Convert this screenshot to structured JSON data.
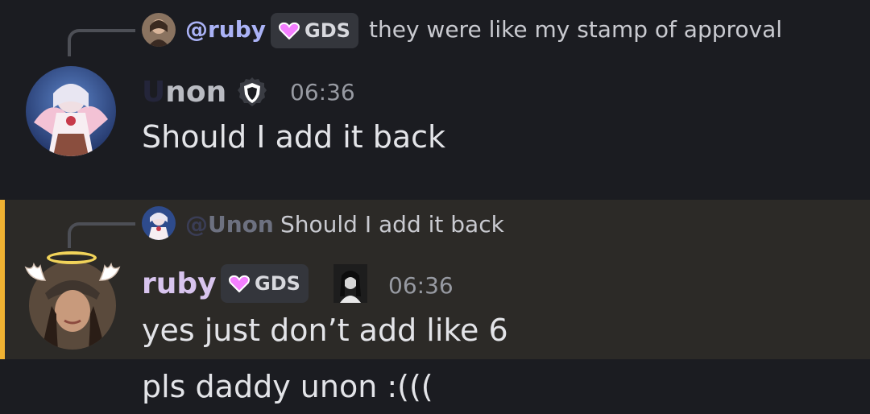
{
  "messages": [
    {
      "reply": {
        "mention": "@ruby",
        "tag": "GDS",
        "text": "they were like my stamp of approval"
      },
      "author": {
        "name_first": "U",
        "name_rest": "non"
      },
      "timestamp": "06:36",
      "content": "Should I add it back"
    },
    {
      "reply": {
        "mention_at": "@",
        "mention_name": "Unon",
        "text": "Should I add it back"
      },
      "author": {
        "name": "ruby",
        "tag": "GDS"
      },
      "timestamp": "06:36",
      "content": "yes just don’t add like 6",
      "highlighted": true
    },
    {
      "content": "pls daddy unon :((("
    }
  ],
  "colors": {
    "background": "#1b1c21",
    "highlight_background": "#2c2a27",
    "highlight_bar": "#f0b232",
    "mention": "#aab2f6",
    "ruby_name": "#d8c4ee",
    "tag_heart": "#f47fff"
  },
  "icons": [
    "shield-icon",
    "heart-icon",
    "halo-icon",
    "wing-icon"
  ]
}
